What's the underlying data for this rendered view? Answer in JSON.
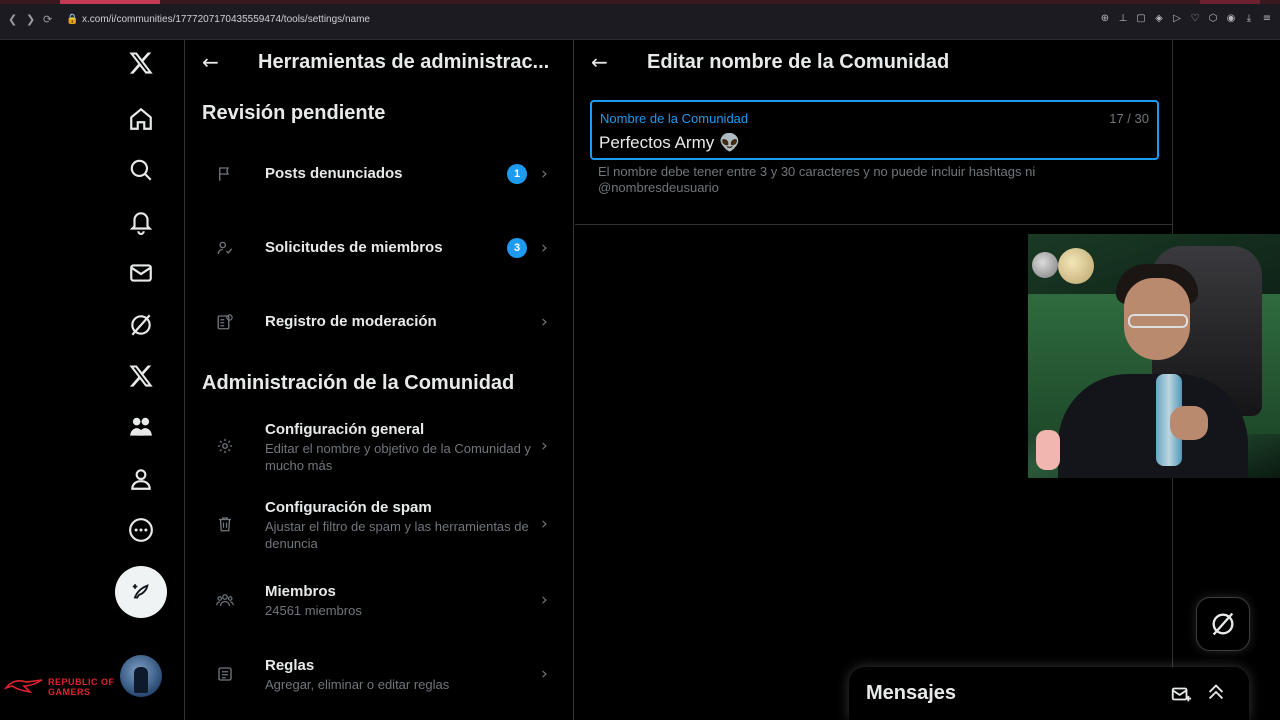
{
  "browser": {
    "url": "x.com/i/communities/1777207170435559474/tools/settings/name",
    "back_glyph": "❮",
    "forward_glyph": "❯",
    "reload_glyph": "⟳",
    "lock_glyph": "🔒",
    "extension_icons": [
      "zoom-icon",
      "pin-icon",
      "reader-icon",
      "shield-icon",
      "play-icon",
      "heart-icon",
      "extensions-icon",
      "account-icon",
      "download-icon",
      "menu-icon"
    ]
  },
  "nav": {
    "items": [
      "x-logo-icon",
      "home-icon",
      "search-icon",
      "notifications-icon",
      "messages-icon",
      "grok-icon",
      "premium-x-icon",
      "communities-icon",
      "profile-icon",
      "more-icon"
    ],
    "post_button_icon": "compose-post-icon",
    "avatar": "user-avatar"
  },
  "branding": {
    "line1": "REPUBLIC OF",
    "line2": "GAMERS"
  },
  "admin": {
    "title": "Herramientas de administrac...",
    "back_glyph": "←",
    "pending_section": "Revisión pendiente",
    "pending_items": [
      {
        "label": "Posts denunciados",
        "badge": "1",
        "icon": "flag-icon"
      },
      {
        "label": "Solicitudes de miembros",
        "badge": "3",
        "icon": "person-check-icon"
      },
      {
        "label": "Registro de moderación",
        "badge": "",
        "icon": "moderation-log-icon"
      }
    ],
    "community_section": "Administración de la Comunidad",
    "community_items": [
      {
        "label": "Configuración general",
        "sub": "Editar el nombre y objetivo de la Comunidad y mucho más",
        "icon": "gear-icon"
      },
      {
        "label": "Configuración de spam",
        "sub": "Ajustar el filtro de spam y las herramientas de denuncia",
        "icon": "trash-icon"
      },
      {
        "label": "Miembros",
        "sub": "24561 miembros",
        "icon": "members-icon"
      },
      {
        "label": "Reglas",
        "sub": "Agregar, eliminar o editar reglas",
        "icon": "rules-icon"
      }
    ],
    "chevron_glyph": "›"
  },
  "edit": {
    "title": "Editar nombre de la Comunidad",
    "back_glyph": "←",
    "field_label": "Nombre de la Comunidad",
    "counter": "17 / 30",
    "value": "Perfectos Army 👽",
    "hint": "El nombre debe tener entre 3 y 30 caracteres y no puede incluir hashtags ni @nombresdeusuario"
  },
  "messages": {
    "title": "Mensajes",
    "new_message_icon": "new-message-icon",
    "expand_icon": "expand-up-icon"
  },
  "colors": {
    "accent": "#1d9bf0",
    "muted": "#71767b",
    "text": "#e7e9ea",
    "border": "#2f3336",
    "rog_red": "#e0222f"
  }
}
